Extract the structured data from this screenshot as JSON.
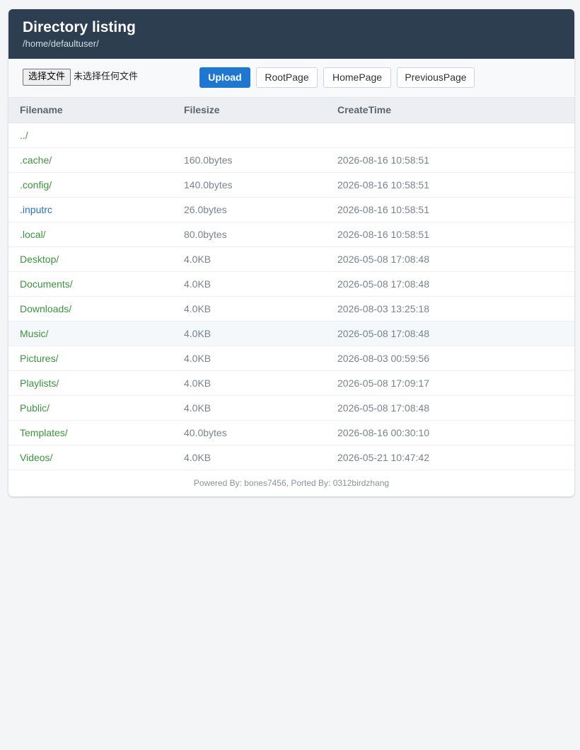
{
  "header": {
    "title": "Directory listing",
    "path": "/home/defaultuser/"
  },
  "toolbar": {
    "choose_file_label": "选择文件",
    "no_file_label": "未选择任何文件",
    "upload_label": "Upload",
    "root_label": "RootPage",
    "home_label": "HomePage",
    "previous_label": "PreviousPage"
  },
  "table": {
    "columns": [
      "Filename",
      "Filesize",
      "CreateTime"
    ],
    "rows": [
      {
        "name": "../",
        "size": "",
        "time": "",
        "kind": "dir"
      },
      {
        "name": ".cache/",
        "size": "160.0bytes",
        "time": "2026-08-16 10:58:51",
        "kind": "dir"
      },
      {
        "name": ".config/",
        "size": "140.0bytes",
        "time": "2026-08-16 10:58:51",
        "kind": "dir"
      },
      {
        "name": ".inputrc",
        "size": "26.0bytes",
        "time": "2026-08-16 10:58:51",
        "kind": "file"
      },
      {
        "name": ".local/",
        "size": "80.0bytes",
        "time": "2026-08-16 10:58:51",
        "kind": "dir"
      },
      {
        "name": "Desktop/",
        "size": "4.0KB",
        "time": "2026-05-08 17:08:48",
        "kind": "dir"
      },
      {
        "name": "Documents/",
        "size": "4.0KB",
        "time": "2026-05-08 17:08:48",
        "kind": "dir"
      },
      {
        "name": "Downloads/",
        "size": "4.0KB",
        "time": "2026-08-03 13:25:18",
        "kind": "dir"
      },
      {
        "name": "Music/",
        "size": "4.0KB",
        "time": "2026-05-08 17:08:48",
        "kind": "dir"
      },
      {
        "name": "Pictures/",
        "size": "4.0KB",
        "time": "2026-08-03 00:59:56",
        "kind": "dir"
      },
      {
        "name": "Playlists/",
        "size": "4.0KB",
        "time": "2026-05-08 17:09:17",
        "kind": "dir"
      },
      {
        "name": "Public/",
        "size": "4.0KB",
        "time": "2026-05-08 17:08:48",
        "kind": "dir"
      },
      {
        "name": "Templates/",
        "size": "40.0bytes",
        "time": "2026-08-16 00:30:10",
        "kind": "dir"
      },
      {
        "name": "Videos/",
        "size": "4.0KB",
        "time": "2026-05-21 10:47:42",
        "kind": "dir"
      }
    ]
  },
  "footer": {
    "text": "Powered By: bones7456, Ported By: 0312birdzhang"
  },
  "colors": {
    "header_bg": "#2c3e50",
    "primary": "#1f77d0",
    "dir_link": "#3f9142",
    "file_link": "#2e6fb8"
  }
}
